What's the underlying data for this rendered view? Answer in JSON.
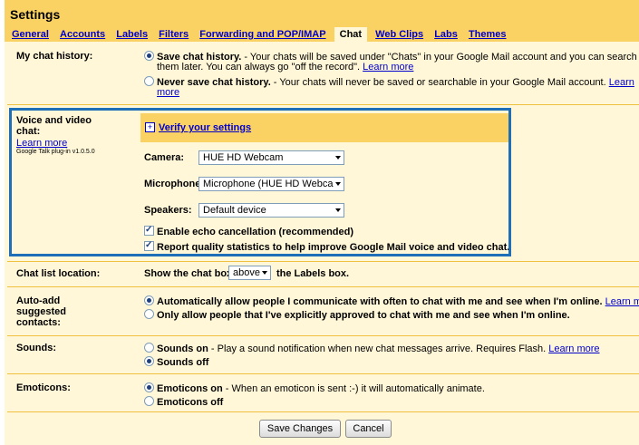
{
  "header": {
    "title": "Settings",
    "tabs": [
      "General",
      "Accounts",
      "Labels",
      "Filters",
      "Forwarding and POP/IMAP",
      "Chat",
      "Web Clips",
      "Labs",
      "Themes"
    ]
  },
  "history": {
    "label": "My chat history:",
    "save_bold": "Save chat history.",
    "save_line1": " - Your chats will be saved under \"Chats\" in your Google Mail account and you can search for",
    "save_line2": "them later. You can always go \"off the record\". ",
    "learn_more": "Learn more",
    "never_bold": "Never save chat history.",
    "never_line1": " - Your chats will never be saved or searchable in your Google Mail account. ",
    "learn_more_2a": "Learn",
    "learn_more_2b": "more"
  },
  "voice": {
    "label_line1": "Voice and video",
    "label_line2": "chat:",
    "learn_more": "Learn more",
    "plugin": "Google Talk plug-in v1.0.5.0",
    "verify": "Verify your settings",
    "camera_label": "Camera:",
    "camera_value": "HUE HD Webcam",
    "microphone_label": "Microphone:",
    "microphone_value": "Microphone (HUE HD Webca",
    "speakers_label": "Speakers:",
    "speakers_value": "Default device",
    "echo": "Enable echo cancellation (recommended)",
    "quality": "Report quality statistics to help improve Google Mail voice and video chat."
  },
  "chatlist": {
    "label": "Chat list location:",
    "prefix": "Show the chat box",
    "value": "above",
    "suffix": "the Labels box."
  },
  "autoadd": {
    "label_line1": "Auto-add",
    "label_line2": "suggested",
    "label_line3": "contacts:",
    "auto": "Automatically allow people I communicate with often to chat with me and see when I'm online.",
    "learn_more": "Learn more",
    "only": "Only allow people that I've explicitly approved to chat with me and see when I'm online."
  },
  "sounds": {
    "label": "Sounds:",
    "on_bold": "Sounds on",
    "on_text": " - Play a sound notification when new chat messages arrive. Requires Flash. ",
    "learn_more": "Learn more",
    "off": "Sounds off"
  },
  "emoticons": {
    "label": "Emoticons:",
    "on_bold": "Emoticons on",
    "on_text": " - When an emoticon is sent :-) it will automatically animate.",
    "off": "Emoticons off"
  },
  "buttons": {
    "save": "Save Changes",
    "cancel": "Cancel"
  },
  "colors": {
    "header": "#fad163",
    "body": "#fff7d7",
    "link": "#0000cc",
    "highlight_border": "#1f6fb8"
  }
}
